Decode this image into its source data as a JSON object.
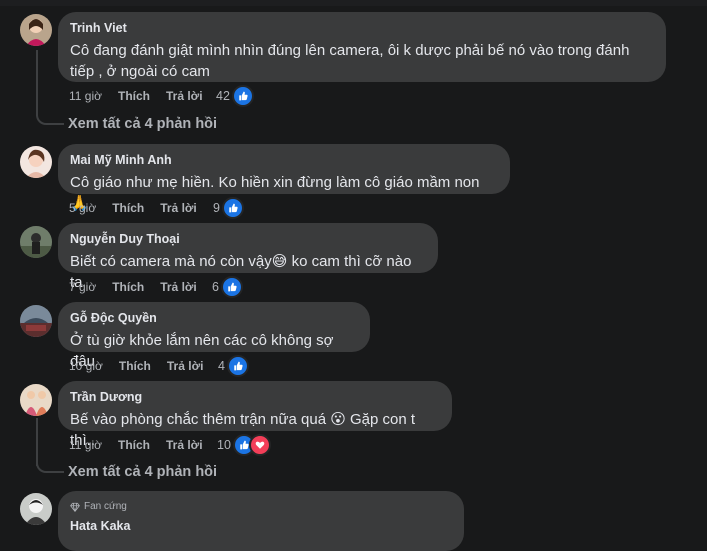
{
  "comments": [
    {
      "name": "Trinh Viet",
      "text": "Cô đang đánh giật mình nhìn đúng lên camera, ôi k dược phải bế nó vào trong đánh tiếp , ở ngoài có cam",
      "time": "11 giờ",
      "like_label": "Thích",
      "reply_label": "Trả lời",
      "reactions": "42",
      "view_replies": "Xem tất cả 4 phản hồi"
    },
    {
      "name": "Mai Mỹ Minh Anh",
      "text": "Cô giáo như mẹ hiền. Ko hiền xin đừng làm cô giáo mầm non 🙏",
      "time": "5 giờ",
      "like_label": "Thích",
      "reply_label": "Trả lời",
      "reactions": "9"
    },
    {
      "name": "Nguyễn Duy Thoại",
      "text": "Biết có camera mà nó còn vậy😅 ko cam thì cỡ nào ta",
      "time": "7 giờ",
      "like_label": "Thích",
      "reply_label": "Trả lời",
      "reactions": "6"
    },
    {
      "name": "Gỗ Độc Quyền",
      "text": "Ở tù giờ khỏe lắm nên các cô không sợ đâu",
      "time": "10 giờ",
      "like_label": "Thích",
      "reply_label": "Trả lời",
      "reactions": "4"
    },
    {
      "name": "Trần Dương",
      "text": "Bế vào phòng chắc thêm trận nữa quá 😮 Gặp con t thì..",
      "time": "11 giờ",
      "like_label": "Thích",
      "reply_label": "Trả lời",
      "reactions": "10",
      "view_replies": "Xem tất cả 4 phản hồi"
    },
    {
      "badge": "Fan cứng",
      "name": "Hata Kaka"
    }
  ],
  "icons": {
    "like": "thumbs-up-icon",
    "love": "heart-icon",
    "badge": "diamond-icon"
  },
  "colors": {
    "background": "#18191a",
    "bubble": "#3a3b3c",
    "like_blue": "#1b74e4",
    "love_red": "#f33e58",
    "secondary_text": "#b0b3b8"
  }
}
